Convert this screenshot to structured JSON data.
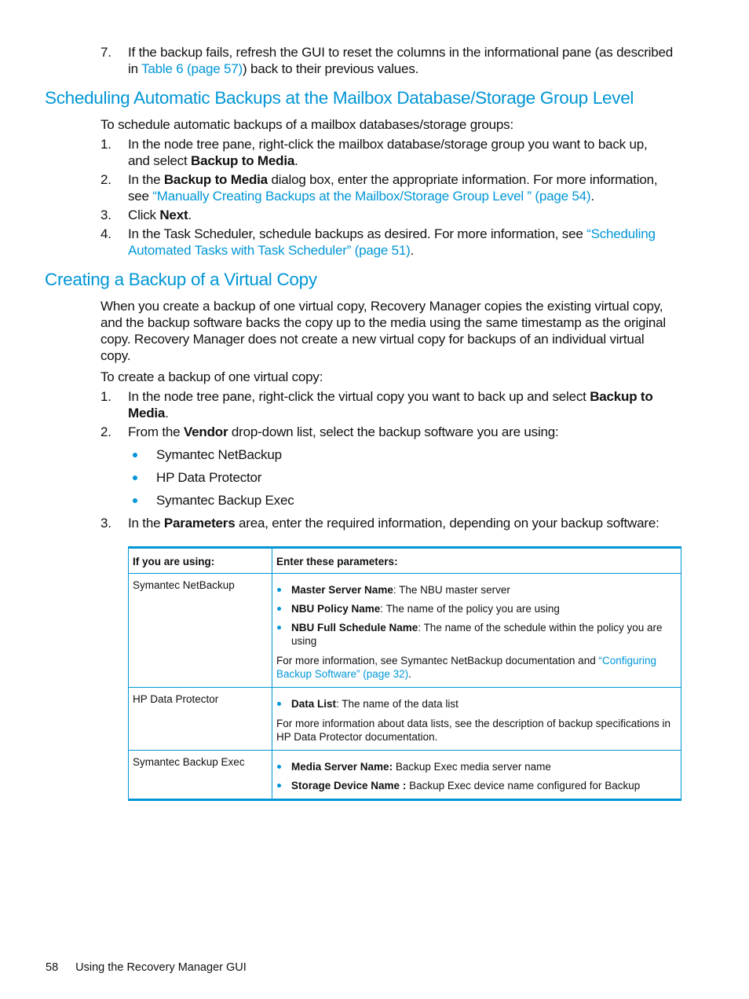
{
  "step7": {
    "number": "7.",
    "text_a": "If the backup fails, refresh the GUI to reset the columns in the informational pane (as described",
    "text_b_prefix": "in ",
    "text_b_link": "Table 6 (page 57)",
    "text_b_suffix": ") back to their previous values."
  },
  "section1": {
    "heading": "Scheduling Automatic Backups at the Mailbox Database/Storage Group Level",
    "intro": "To schedule automatic backups of a mailbox databases/storage groups:",
    "steps": [
      {
        "number": "1.",
        "line1": "In the node tree pane, right-click the mailbox database/storage group you want to back up,",
        "line2_prefix": "and select ",
        "line2_bold": "Backup to Media",
        "line2_suffix": "."
      },
      {
        "number": "2.",
        "line1_prefix": "In the ",
        "line1_bold": "Backup to Media",
        "line1_suffix": " dialog box, enter the appropriate information. For more information,",
        "line2_prefix": "see ",
        "line2_link": "“Manually Creating Backups at the Mailbox/Storage Group Level ” (page 54)",
        "line2_suffix": "."
      },
      {
        "number": "3.",
        "prefix": "Click ",
        "bold": "Next",
        "suffix": "."
      },
      {
        "number": "4.",
        "line1_prefix": "In the Task Scheduler, schedule backups as desired. For more information, see ",
        "line1_link": "“Scheduling",
        "line2_link": "Automated Tasks with Task Scheduler” (page 51)",
        "line2_suffix": "."
      }
    ]
  },
  "section2": {
    "heading": "Creating a Backup of a Virtual Copy",
    "para_lines": [
      "When you create a backup of one virtual copy, Recovery Manager copies the existing virtual copy,",
      "and the backup software backs the copy up to the media using the same timestamp as the original",
      "copy. Recovery Manager does not create a new virtual copy for backups of an individual virtual",
      "copy."
    ],
    "intro": "To create a backup of one virtual copy:",
    "step1": {
      "number": "1.",
      "line1_prefix": "In the node tree pane, right-click the virtual copy you want to back up and select ",
      "line1_bold": "Backup to",
      "line2_bold": "Media",
      "line2_suffix": "."
    },
    "step2": {
      "number": "2.",
      "prefix": "From the ",
      "bold": "Vendor",
      "suffix": " drop-down list, select the backup software you are using:"
    },
    "vendors": [
      "Symantec NetBackup",
      "HP Data Protector",
      "Symantec Backup Exec"
    ],
    "step3": {
      "number": "3.",
      "prefix": "In the ",
      "bold": "Parameters",
      "suffix": " area, enter the required information, depending on your backup software:"
    }
  },
  "table": {
    "headers": [
      "If you are using:",
      "Enter these parameters:"
    ],
    "rows": [
      {
        "software": "Symantec NetBackup",
        "params": [
          {
            "name": "Master Server Name",
            "sep": ": ",
            "desc": "The NBU master server"
          },
          {
            "name": "NBU Policy Name",
            "sep": ": ",
            "desc": "The name of the policy you are using"
          },
          {
            "name": "NBU Full Schedule Name",
            "sep": ": ",
            "desc": "The name of the schedule within the policy you are using"
          }
        ],
        "note_prefix": "For more information, see Symantec NetBackup documentation and ",
        "note_link": "“Configuring Backup Software” (page 32)",
        "note_suffix": "."
      },
      {
        "software": "HP Data Protector",
        "params": [
          {
            "name": "Data List",
            "sep": ": ",
            "desc": "The name of the data list"
          }
        ],
        "note_prefix": "For more information about data lists, see the description of backup specifications in HP Data Protector documentation."
      },
      {
        "software": "Symantec Backup Exec",
        "params": [
          {
            "name": "Media Server Name:",
            "sep": " ",
            "desc": "Backup Exec media server name"
          },
          {
            "name": "Storage Device Name :",
            "sep": " ",
            "desc": "Backup Exec device name configured for Backup"
          }
        ]
      }
    ]
  },
  "footer": {
    "page_number": "58",
    "chapter": "Using the Recovery Manager GUI"
  }
}
